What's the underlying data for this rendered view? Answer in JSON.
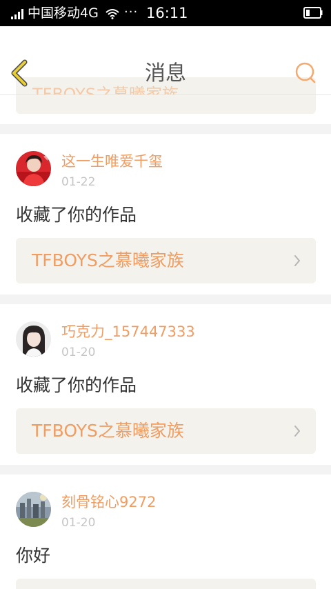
{
  "status_bar": {
    "carrier": "中国移动4G",
    "dots": "···",
    "time": "16:11"
  },
  "nav": {
    "title": "消息",
    "peek_text": "TFBOYS之慕曦家族"
  },
  "messages": [
    {
      "username": "这一生唯爱千玺",
      "date": "01-22",
      "action": "收藏了你的作品",
      "work_title": "TFBOYS之慕曦家族",
      "avatar_icon": "avatar-red-icon"
    },
    {
      "username": "巧克力_157447333",
      "date": "01-20",
      "action": "收藏了你的作品",
      "work_title": "TFBOYS之慕曦家族",
      "avatar_icon": "avatar-girl-icon"
    },
    {
      "username": "刻骨铭心9272",
      "date": "01-20",
      "action": "你好",
      "avatar_icon": "avatar-landscape-icon"
    }
  ],
  "colors": {
    "accent": "#f09d63",
    "back_icon": "#e8cf3a",
    "link_bg": "#f3f2ec",
    "page_bg": "#f3f3f3"
  }
}
